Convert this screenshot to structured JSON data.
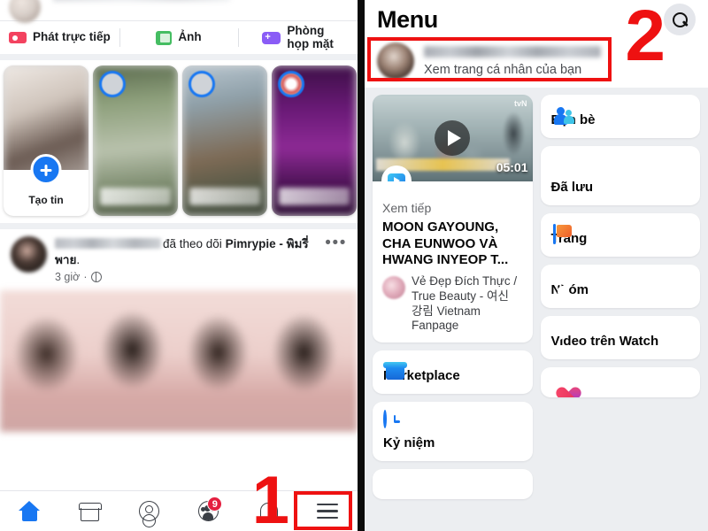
{
  "left_phone": {
    "composer": {
      "avatar_icon": "user-avatar"
    },
    "actions": [
      {
        "label": "Phát trực tiếp",
        "icon": "live-video-icon"
      },
      {
        "label": "Ảnh",
        "icon": "photo-icon"
      },
      {
        "label": "Phòng\nhọp mặt",
        "label_line1": "Phòng",
        "label_line2": "họp mặt",
        "icon": "video-room-icon"
      }
    ],
    "stories": {
      "create_label": "Tạo tin",
      "create_icon": "plus-icon",
      "items": [
        {
          "name": "",
          "ring_icon": "story-avatar-ring"
        },
        {
          "name": "",
          "ring_icon": "story-avatar-ring"
        },
        {
          "name": "",
          "ring_icon": "story-avatar-ring"
        }
      ]
    },
    "post": {
      "author": "",
      "action_text": "đã theo dõi",
      "target_bold": "Pimrypie - พิมรี่พาย",
      "trailing": ".",
      "time": "3 giờ",
      "privacy_icon": "globe-icon",
      "more_icon": "more-options-icon",
      "more_glyph": "•••"
    },
    "bottom_nav": [
      {
        "name": "home",
        "icon": "home-icon",
        "active": true
      },
      {
        "name": "marketplace",
        "icon": "marketplace-icon",
        "active": false
      },
      {
        "name": "profile",
        "icon": "person-icon",
        "active": false
      },
      {
        "name": "groups",
        "icon": "groups-icon",
        "active": false,
        "badge": "9"
      },
      {
        "name": "notifications",
        "icon": "bell-icon",
        "active": false
      },
      {
        "name": "menu",
        "icon": "hamburger-menu-icon",
        "active": false,
        "highlighted": true
      }
    ],
    "step_marker": "1",
    "highlight_color": "#ee1111"
  },
  "right_phone": {
    "header": {
      "title": "Menu",
      "search_icon": "search-icon"
    },
    "profile": {
      "name": "",
      "subtitle": "Xem trang cá nhân của bạn",
      "avatar_icon": "user-avatar"
    },
    "step_marker": "2",
    "video_card": {
      "duration": "05:01",
      "channel_watermark": "tvN",
      "kicker": "Xem tiếp",
      "title": "MOON GAYOUNG, CHA EUNWOO VÀ HWANG INYEOP T...",
      "page_name": "Vẻ Đẹp Đích Thực / True Beauty - 여신 강림 Vietnam Fanpage",
      "play_icon": "play-icon",
      "watch_badge_icon": "watch-icon"
    },
    "menu_items_left": [
      {
        "label": "Marketplace",
        "icon": "marketplace-icon"
      },
      {
        "label": "Kỷ niệm",
        "icon": "memories-clock-icon"
      },
      {
        "label": "",
        "icon": "events-icon"
      }
    ],
    "menu_items_right": [
      {
        "label": "Bạn bè",
        "icon": "friends-icon"
      },
      {
        "label": "Đã lưu",
        "icon": "bookmark-icon"
      },
      {
        "label": "Trang",
        "icon": "pages-flag-icon"
      },
      {
        "label": "Nhóm",
        "icon": "groups-icon"
      },
      {
        "label": "Video trên Watch",
        "icon": "watch-icon"
      },
      {
        "label": "",
        "icon": "dating-heart-icon"
      }
    ]
  }
}
